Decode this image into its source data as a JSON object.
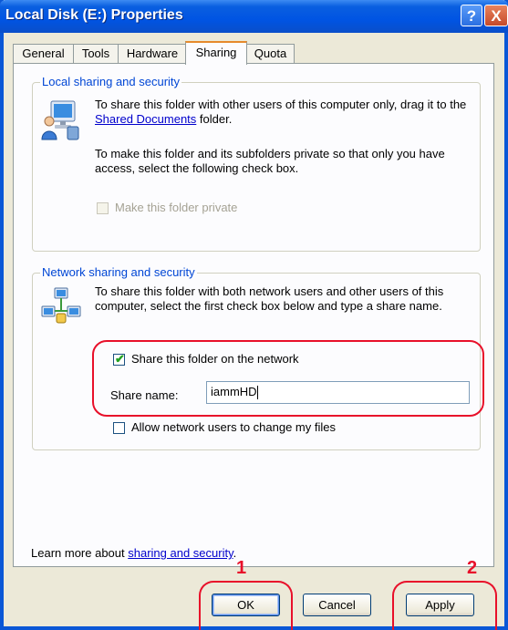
{
  "window": {
    "title": "Local Disk (E:) Properties",
    "help_label": "?",
    "close_label": "X"
  },
  "tabs": [
    {
      "label": "General"
    },
    {
      "label": "Tools"
    },
    {
      "label": "Hardware"
    },
    {
      "label": "Sharing"
    },
    {
      "label": "Quota"
    }
  ],
  "active_tab": "Sharing",
  "local_sharing": {
    "title": "Local sharing and security",
    "text1_before": "To share this folder with other users of this computer only, drag it to the ",
    "text1_link": "Shared Documents",
    "text1_after": " folder.",
    "text2": "To make this folder and its subfolders private so that only you have access, select the following check box.",
    "private_checkbox_label": "Make this folder private",
    "private_checked": false,
    "private_enabled": false,
    "icon": "users-computer-icon"
  },
  "network_sharing": {
    "title": "Network sharing and security",
    "text": "To share this folder with both network users and other users of this computer, select the first check box below and type a share name.",
    "share_checkbox_label": "Share this folder on the network",
    "share_checked": true,
    "share_name_label": "Share name:",
    "share_name_value": "iammHD",
    "allow_change_label": "Allow network users to change my files",
    "allow_change_checked": false,
    "icon": "network-share-icon"
  },
  "learn_more": {
    "before": "Learn more about ",
    "link": "sharing and security",
    "after": "."
  },
  "buttons": {
    "ok": "OK",
    "cancel": "Cancel",
    "apply": "Apply"
  },
  "annotations": {
    "marker1": "1",
    "marker2": "2",
    "color": "#e8102a"
  }
}
